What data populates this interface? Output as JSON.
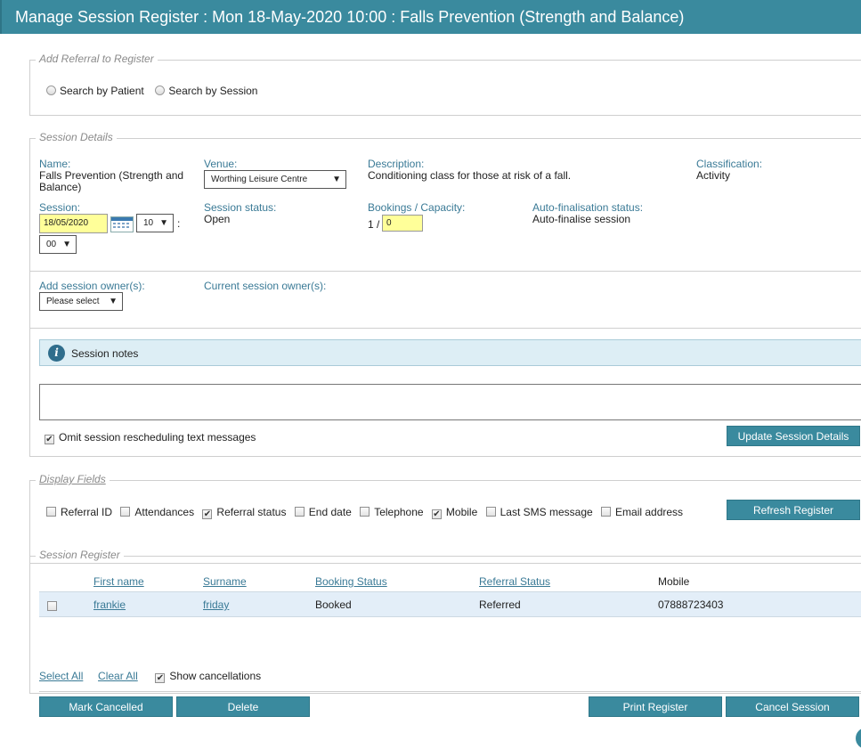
{
  "window": {
    "title": "Manage Session Register : Mon 18-May-2020 10:00 : Falls Prevention (Strength and Balance)"
  },
  "add_referral": {
    "legend": "Add Referral to Register",
    "opt_patient": "Search by Patient",
    "opt_session": "Search by Session"
  },
  "session_details": {
    "legend": "Session Details",
    "name_label": "Name:",
    "name_value": "Falls Prevention (Strength and Balance)",
    "venue_label": "Venue:",
    "venue_value": "Worthing Leisure Centre",
    "description_label": "Description:",
    "description_value": "Conditioning class for those at risk of a fall.",
    "classification_label": "Classification:",
    "classification_value": "Activity",
    "session_label": "Session:",
    "session_date": "18/05/2020",
    "session_hour": "10",
    "session_minute": "00",
    "time_sep": ":",
    "status_label": "Session status:",
    "status_value": "Open",
    "bookings_label": "Bookings / Capacity:",
    "bookings_value": "1 /",
    "capacity_value": "0",
    "autofinal_label": "Auto-finalisation status:",
    "autofinal_value": "Auto-finalise session",
    "add_owner_label": "Add session owner(s):",
    "add_owner_value": "Please select",
    "current_owner_label": "Current session owner(s):",
    "notes_title": "Session notes",
    "notes_value": "",
    "omit_sms_label": "Omit session rescheduling text messages",
    "omit_sms_checked": true,
    "update_button": "Update Session Details"
  },
  "display_fields": {
    "legend": "Display Fields",
    "fields": [
      {
        "label": "Referral ID",
        "checked": false
      },
      {
        "label": "Attendances",
        "checked": false
      },
      {
        "label": "Referral status",
        "checked": true
      },
      {
        "label": "End date",
        "checked": false
      },
      {
        "label": "Telephone",
        "checked": false
      },
      {
        "label": "Mobile",
        "checked": true
      },
      {
        "label": "Last SMS message",
        "checked": false
      },
      {
        "label": "Email address",
        "checked": false
      }
    ],
    "refresh_button": "Refresh Register"
  },
  "register": {
    "legend": "Session Register",
    "columns": [
      "First name",
      "Surname",
      "Booking Status",
      "Referral Status",
      "Mobile"
    ],
    "rows": [
      {
        "first_name": "frankie",
        "surname": "friday",
        "booking_status": "Booked",
        "referral_status": "Referred",
        "mobile": "07888723403"
      }
    ],
    "select_all": "Select All",
    "clear_all": "Clear All",
    "show_cancellations": "Show cancellations",
    "show_cancellations_checked": true,
    "btn_mark_cancelled": "Mark Cancelled",
    "btn_delete": "Delete",
    "btn_print": "Print Register",
    "btn_cancel_session": "Cancel Session"
  },
  "colors": {
    "accent": "#3a8a9e",
    "label": "#3a7a96",
    "highlight": "#ffff99",
    "row_bg": "#e3eef8"
  }
}
